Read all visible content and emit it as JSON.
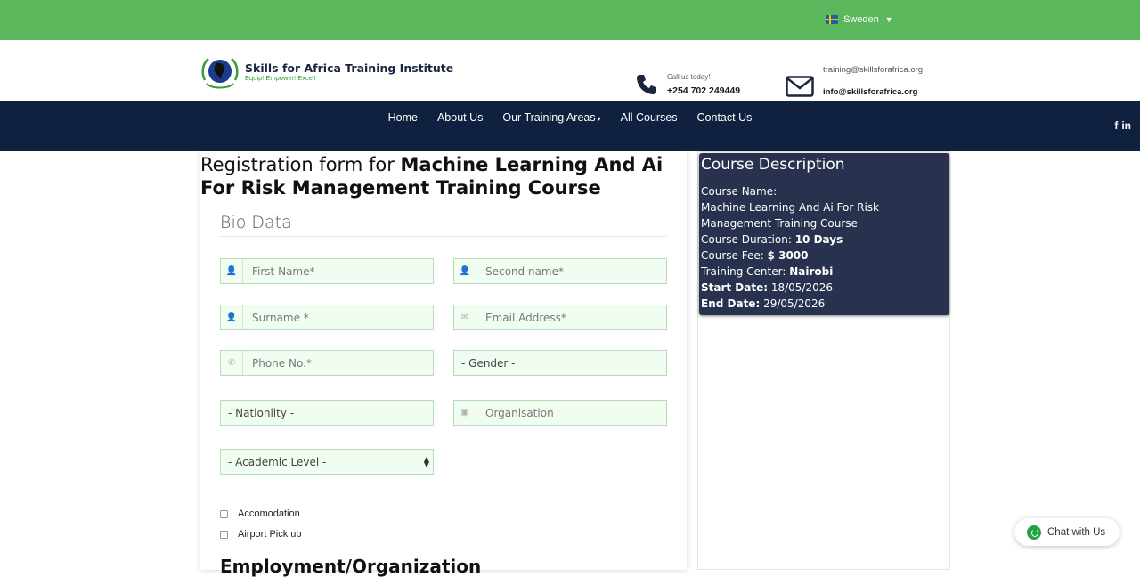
{
  "topbar": {
    "language": "Sweden",
    "caret": "▼"
  },
  "header": {
    "brand_name": "Skills for Africa Training Institute",
    "brand_tagline": "Equip! Empower! Excel!",
    "call_label": "Call us today!",
    "call_number": "+254 702 249449",
    "email_primary": "training@skillsforafrica.org",
    "email_secondary": "info@skillsforafrica.org"
  },
  "nav": {
    "items": [
      "Home",
      "About Us",
      "Our Training Areas",
      "All Courses",
      "Contact Us"
    ],
    "social": [
      "f",
      "in"
    ]
  },
  "form": {
    "title_prefix": "Registration form for ",
    "title_course": "Machine Learning And Ai For Risk Management Training Course",
    "section_bio": "Bio Data",
    "fields": {
      "first_name": "First Name*",
      "second_name": "Second name*",
      "surname": "Surname *",
      "email": "Email Address*",
      "phone": "Phone No.*",
      "gender": "- Gender -",
      "nationality": "- Nationlity -",
      "organisation": "Organisation",
      "academic_level": "- Academic Level -"
    },
    "checkboxes": {
      "accommodation": "Accomodation",
      "airport_pickup": "Airport Pick up"
    },
    "next_section": "Employment/Organization"
  },
  "course": {
    "heading": "Course Description",
    "name_label": "Course Name:",
    "name_value": "Machine Learning And Ai For Risk Management Training Course",
    "duration_label": "Course Duration: ",
    "duration_value": "10 Days",
    "fee_label": "Course Fee: ",
    "fee_value": "$ 3000",
    "center_label": "Training Center: ",
    "center_value": "Nairobi",
    "start_label": "Start Date:",
    "start_value": " 18/05/2026",
    "end_label": "End Date:",
    "end_value": " 29/05/2026"
  },
  "chat": {
    "label": "Chat with Us"
  },
  "colors": {
    "topbar": "#5cb85c",
    "nav": "#0f213e",
    "course_card": "#28324f",
    "field_bg": "#f0fdf0"
  }
}
